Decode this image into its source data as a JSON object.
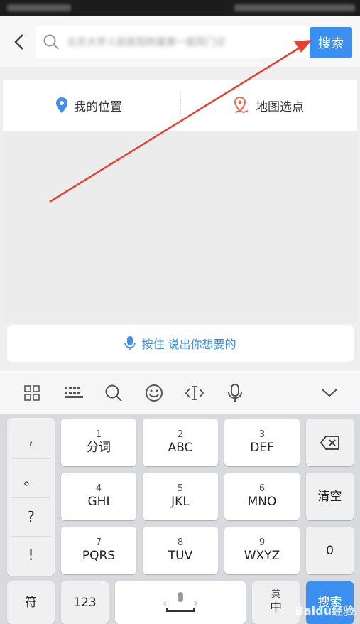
{
  "search": {
    "query": "北京大学人民医院附属第一医院门诊",
    "button_label": "搜索"
  },
  "location": {
    "my_location": "我的位置",
    "map_pick": "地图选点"
  },
  "voice": {
    "hint": "按住 说出你想要的"
  },
  "keyboard": {
    "punct": [
      ",",
      "。",
      "?",
      "!"
    ],
    "keys": [
      {
        "num": "1",
        "label": "分词"
      },
      {
        "num": "2",
        "label": "ABC"
      },
      {
        "num": "3",
        "label": "DEF"
      },
      {
        "num": "4",
        "label": "GHI"
      },
      {
        "num": "5",
        "label": "JKL"
      },
      {
        "num": "6",
        "label": "MNO"
      },
      {
        "num": "7",
        "label": "PQRS"
      },
      {
        "num": "8",
        "label": "TUV"
      },
      {
        "num": "9",
        "label": "WXYZ"
      }
    ],
    "clear_label": "清空",
    "zero_label": "0",
    "symbol_label": "符",
    "numbers_label": "123",
    "lang_top": "英",
    "lang_bottom": "中",
    "enter_label": "搜索"
  },
  "watermark": "Baidu经验",
  "colors": {
    "accent": "#3b8ff0",
    "arrow": "#e8402f",
    "map_pin": "#e86a4a"
  }
}
